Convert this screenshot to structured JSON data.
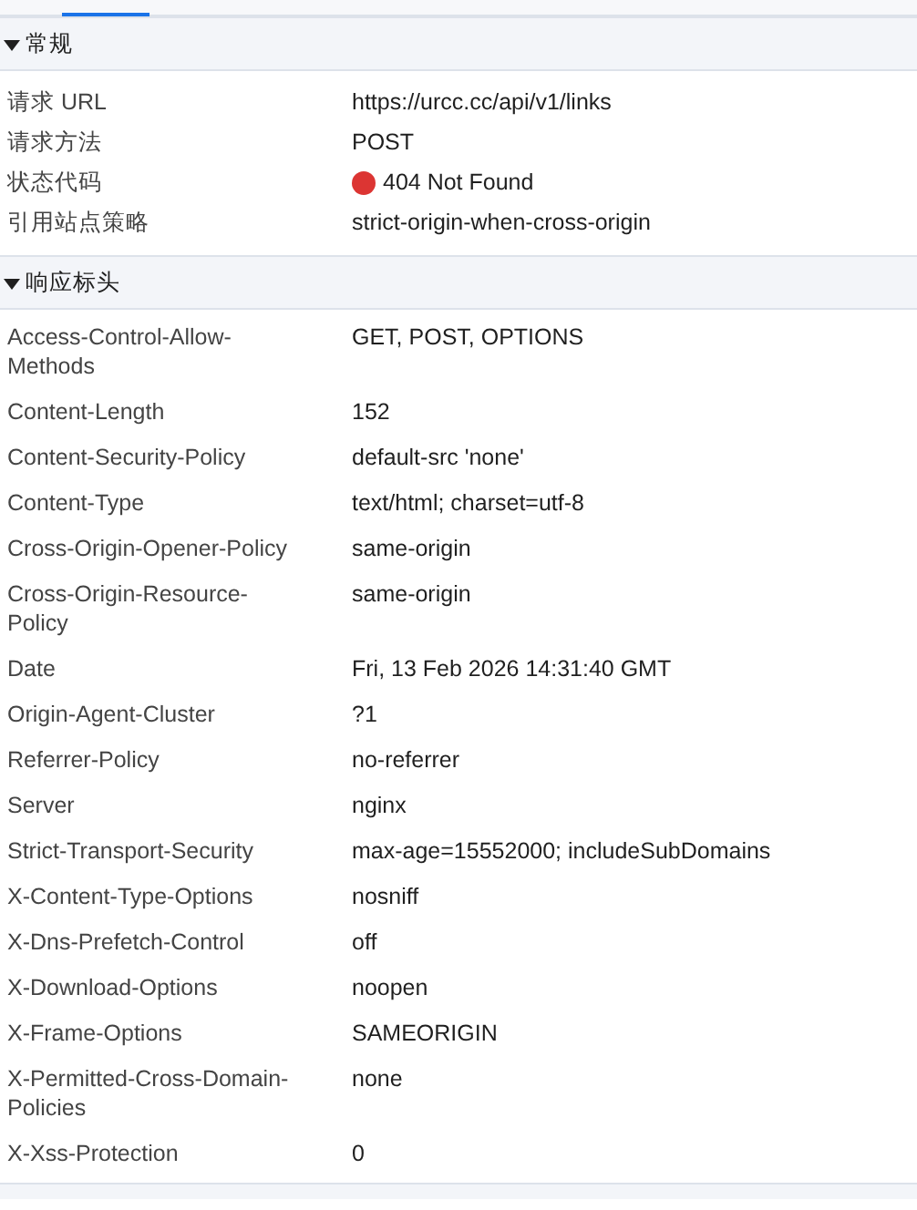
{
  "sections": [
    {
      "title": "常规",
      "expanded": true,
      "rows": [
        {
          "name": "请求 URL",
          "value": "https://urcc.cc/api/v1/links"
        },
        {
          "name": "请求方法",
          "value": "POST"
        },
        {
          "name": "状态代码",
          "value": "404 Not Found",
          "color": "#dc3533"
        },
        {
          "name": "引用站点策略",
          "value": "strict-origin-when-cross-origin"
        }
      ]
    },
    {
      "title": "响应标头",
      "expanded": true,
      "rows": [
        {
          "name": "Access-Control-Allow-Methods",
          "value": "GET, POST, OPTIONS"
        },
        {
          "name": "Content-Length",
          "value": "152"
        },
        {
          "name": "Content-Security-Policy",
          "value": "default-src 'none'"
        },
        {
          "name": "Content-Type",
          "value": "text/html; charset=utf-8"
        },
        {
          "name": "Cross-Origin-Opener-Policy",
          "value": "same-origin"
        },
        {
          "name": "Cross-Origin-Resource-Policy",
          "value": "same-origin"
        },
        {
          "name": "Date",
          "value": "Fri, 13 Feb 2026 14:31:40 GMT"
        },
        {
          "name": "Origin-Agent-Cluster",
          "value": "?1"
        },
        {
          "name": "Referrer-Policy",
          "value": "no-referrer"
        },
        {
          "name": "Server",
          "value": "nginx"
        },
        {
          "name": "Strict-Transport-Security",
          "value": "max-age=15552000; includeSubDomains"
        },
        {
          "name": "X-Content-Type-Options",
          "value": "nosniff"
        },
        {
          "name": "X-Dns-Prefetch-Control",
          "value": "off"
        },
        {
          "name": "X-Download-Options",
          "value": "noopen"
        },
        {
          "name": "X-Frame-Options",
          "value": "SAMEORIGIN"
        },
        {
          "name": "X-Permitted-Cross-Domain-Policies",
          "value": "none"
        },
        {
          "name": "X-Xss-Protection",
          "value": "0"
        }
      ]
    }
  ]
}
